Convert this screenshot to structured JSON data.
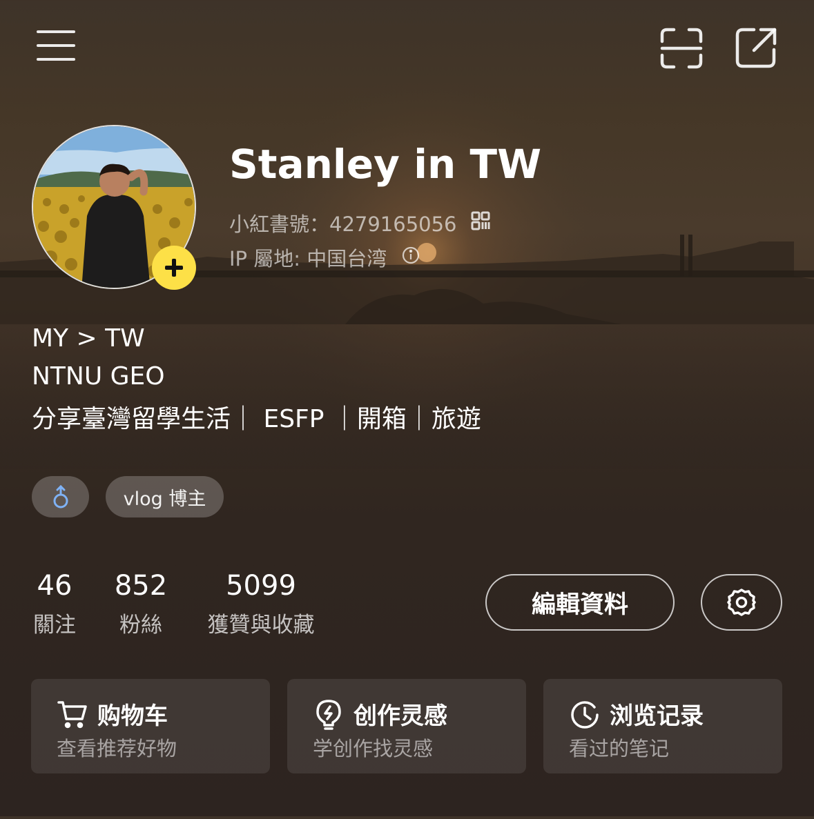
{
  "colors": {
    "accent_yellow": "#fde047",
    "gender_blue": "#7fb2f5",
    "card_bg": "#3b322c"
  },
  "header": {
    "menu_icon": "hamburger-menu-icon",
    "scan_icon": "scan-icon",
    "share_icon": "share-external-icon"
  },
  "profile": {
    "nickname": "Stanley in TW",
    "id_label": "小紅書號：4279165056",
    "ip_label": "IP 屬地: 中国台湾",
    "avatar_badge_icon": "plus-icon"
  },
  "bio": {
    "line1": "MY > TW",
    "line2": "NTNU GEO",
    "line3": "分享臺灣留學生活｜ ESFP ｜開箱｜旅遊"
  },
  "tags": {
    "gender_icon": "male-symbol-icon",
    "gender_symbol": "♂",
    "role": "vlog 博主"
  },
  "stats": [
    {
      "value": "46",
      "label": "關注"
    },
    {
      "value": "852",
      "label": "粉絲"
    },
    {
      "value": "5099",
      "label": "獲贊與收藏"
    }
  ],
  "actions": {
    "edit_profile": "編輯資料",
    "settings_icon": "gear-icon"
  },
  "cards": [
    {
      "title": "购物车",
      "subtitle": "查看推荐好物",
      "icon": "shopping-cart-icon"
    },
    {
      "title": "创作灵感",
      "subtitle": "学创作找灵感",
      "icon": "lightbulb-icon"
    },
    {
      "title": "浏览记录",
      "subtitle": "看过的笔记",
      "icon": "clock-history-icon"
    }
  ]
}
